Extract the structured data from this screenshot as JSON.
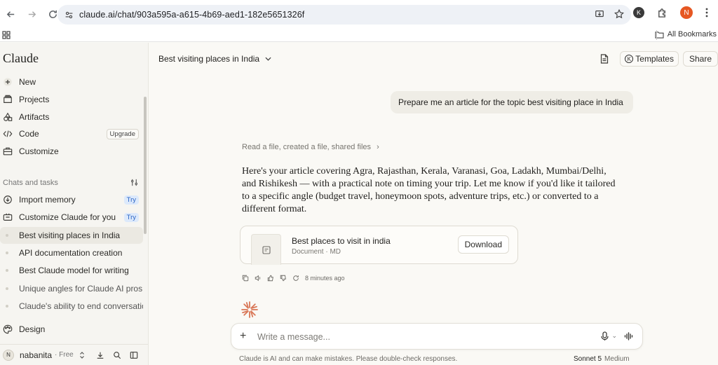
{
  "browser": {
    "url": "claude.ai/chat/903a595a-a615-4b69-aed1-182e5651326f",
    "avatar_k": "K",
    "avatar_n": "N",
    "all_bookmarks": "All Bookmarks"
  },
  "sidebar": {
    "brand": "Claude",
    "nav": [
      {
        "label": "New",
        "icon": "plus-icon"
      },
      {
        "label": "Projects",
        "icon": "folder-icon"
      },
      {
        "label": "Artifacts",
        "icon": "shapes-icon"
      },
      {
        "label": "Code",
        "icon": "code-icon",
        "badge": "Upgrade"
      },
      {
        "label": "Customize",
        "icon": "briefcase-icon"
      }
    ],
    "section_label": "Chats and tasks",
    "chats": [
      {
        "label": "Import memory",
        "badge": "Try",
        "icon": "import-icon"
      },
      {
        "label": "Customize Claude for you",
        "badge": "Try",
        "icon": "customize-icon"
      },
      {
        "label": "Best visiting places in India",
        "active": true
      },
      {
        "label": "API documentation creation"
      },
      {
        "label": "Best Claude model for writing"
      },
      {
        "label": "Unique angles for Claude AI pros"
      },
      {
        "label": "Claude's ability to end conversations"
      }
    ],
    "design_label": "Design",
    "user": {
      "initial": "N",
      "name": "nabanita",
      "plan": "· Free"
    }
  },
  "header": {
    "title": "Best visiting places in India",
    "templates_label": "Templates",
    "templates_k": "K",
    "share_label": "Share"
  },
  "conversation": {
    "user_message": "Prepare me an article for the topic best visiting place in India",
    "tool_summary": "Read a file, created a file, shared files",
    "assistant_text": "Here's your article covering Agra, Rajasthan, Kerala, Varanasi, Goa, Ladakh, Mumbai/Delhi, and Rishikesh — with a practical note on timing your trip. Let me know if you'd like it tailored to a specific angle (budget travel, honeymoon spots, adventure trips, etc.) or converted to a different format.",
    "file": {
      "name": "Best places to visit in india",
      "meta": "Document · MD",
      "download_label": "Download"
    },
    "timestamp": "8 minutes ago"
  },
  "composer": {
    "placeholder": "Write a message...",
    "disclaimer": "Claude is AI and can make mistakes. Please double-check responses.",
    "model": "Sonnet 5",
    "effort": "Medium"
  },
  "colors": {
    "accent": "#d97757",
    "try_badge_bg": "#dce9fb",
    "try_badge_text": "#2a64c5",
    "chrome_avatar": "#e65722"
  }
}
